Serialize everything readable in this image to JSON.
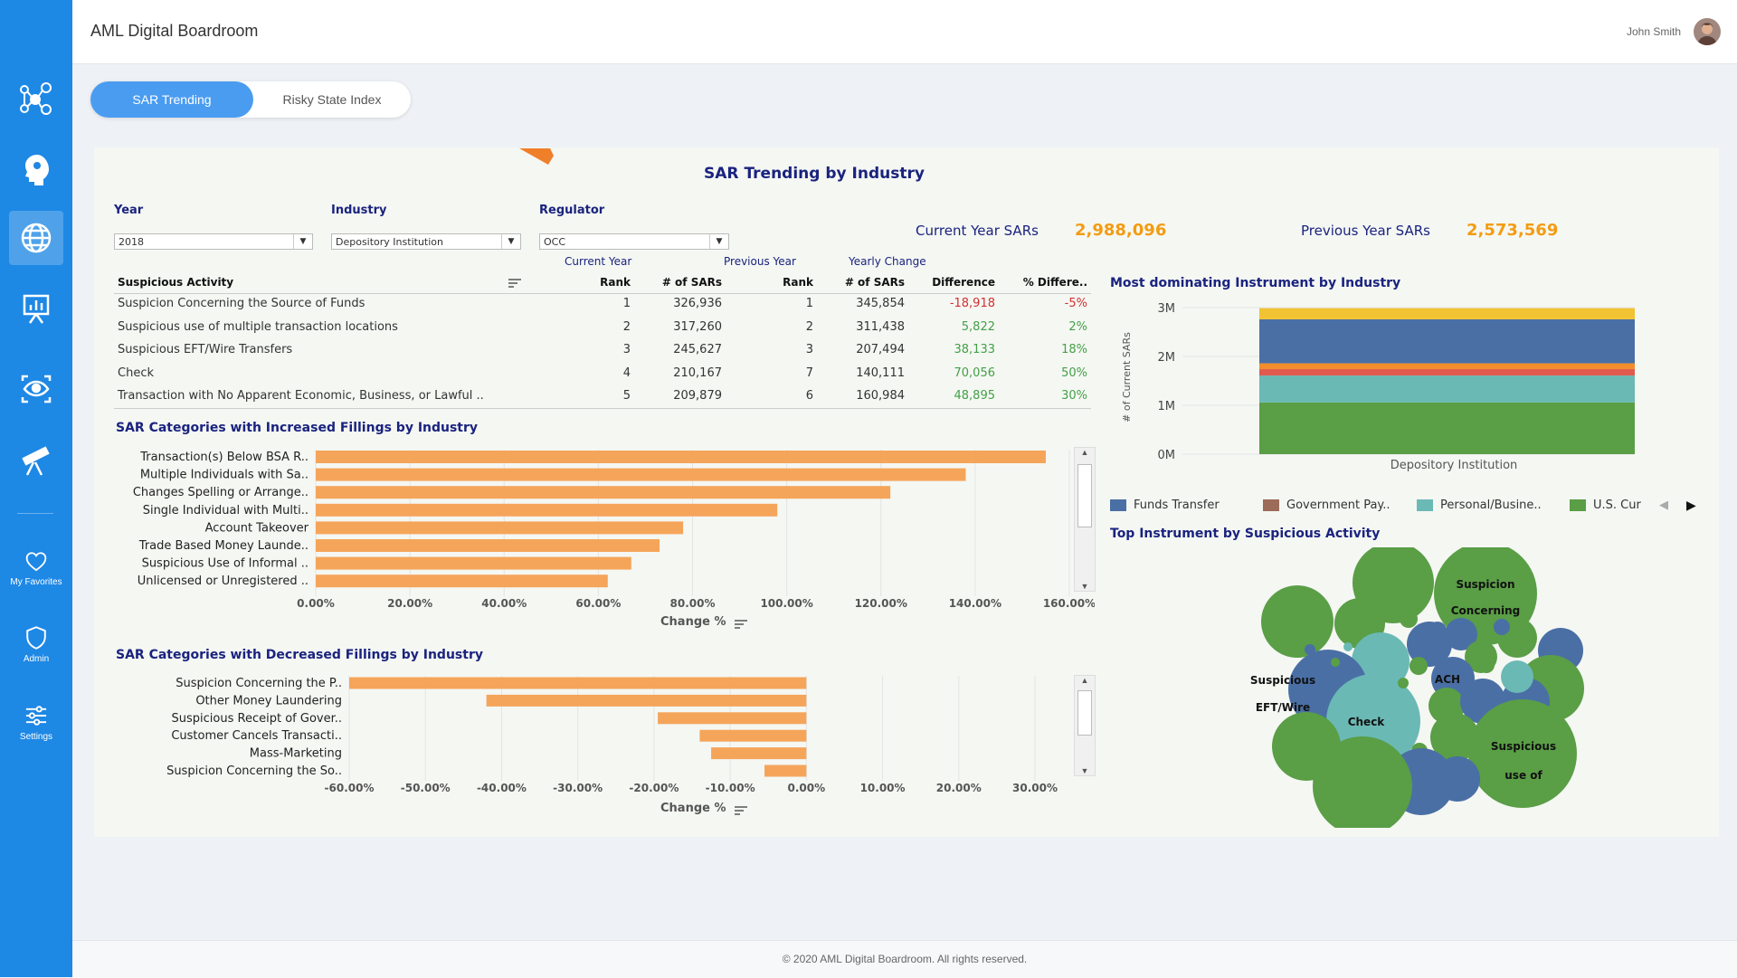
{
  "app": {
    "title": "AML Digital Boardroom",
    "user_name": "John Smith"
  },
  "sidebar": {
    "items": [
      {
        "icon": "network-icon",
        "label": ""
      },
      {
        "icon": "brain-head-icon",
        "label": ""
      },
      {
        "icon": "globe-icon",
        "label": "",
        "active": true
      },
      {
        "icon": "presentation-chart-icon",
        "label": ""
      },
      {
        "icon": "eye-scan-icon",
        "label": ""
      },
      {
        "icon": "telescope-icon",
        "label": ""
      },
      {
        "icon": "heart-icon",
        "label": "My Favorites"
      },
      {
        "icon": "shield-icon",
        "label": "Admin"
      },
      {
        "icon": "sliders-icon",
        "label": "Settings"
      }
    ]
  },
  "tabs": [
    {
      "label": "SAR Trending",
      "active": true
    },
    {
      "label": "Risky State Index",
      "active": false
    }
  ],
  "dashboard": {
    "title": "SAR Trending by Industry",
    "filters": {
      "year": {
        "label": "Year",
        "value": "2018"
      },
      "industry": {
        "label": "Industry",
        "value": "Depository Institution"
      },
      "regulator": {
        "label": "Regulator",
        "value": "OCC"
      }
    },
    "kpis": {
      "current_label": "Current Year SARs",
      "current_value": "2,988,096",
      "previous_label": "Previous Year SARs",
      "previous_value": "2,573,569"
    },
    "table": {
      "group_headers": [
        "Current Year",
        "Previous Year",
        "Yearly Change"
      ],
      "columns": [
        "Suspicious Activity",
        "Rank",
        "# of SARs",
        "Rank",
        "# of SARs",
        "Difference",
        "% Differe.."
      ],
      "rows": [
        [
          "Suspicion Concerning the Source of Funds",
          "1",
          "326,936",
          "1",
          "345,854",
          "-18,918",
          "-5%"
        ],
        [
          "Suspicious use of multiple transaction locations",
          "2",
          "317,260",
          "2",
          "311,438",
          "5,822",
          "2%"
        ],
        [
          "Suspicious EFT/Wire Transfers",
          "3",
          "245,627",
          "3",
          "207,494",
          "38,133",
          "18%"
        ],
        [
          "Check",
          "4",
          "210,167",
          "7",
          "140,111",
          "70,056",
          "50%"
        ],
        [
          "Transaction with No Apparent Economic, Business, or Lawful ..",
          "5",
          "209,879",
          "6",
          "160,984",
          "48,895",
          "30%"
        ]
      ]
    }
  },
  "footer": {
    "text": "© 2020 AML Digital Boardroom. All rights reserved."
  },
  "colors": {
    "accent": "#1e88e5",
    "bar": "#f5a55a",
    "kpi": "#f39c12",
    "title": "#1a237e",
    "green": "#5a9e46",
    "teal": "#6ab9b5",
    "blue": "#4a6fa5"
  },
  "chart_data": [
    {
      "type": "bar",
      "title": "SAR Categories with Increased Fillings by Industry",
      "xlabel": "Change %",
      "orientation": "horizontal",
      "categories": [
        "Transaction(s) Below BSA R..",
        "Multiple Individuals with Sa..",
        "Changes Spelling or Arrange..",
        "Single Individual with Multi..",
        "Account Takeover",
        "Trade Based Money Launde..",
        "Suspicious Use of Informal ..",
        "Unlicensed or Unregistered .."
      ],
      "values": [
        155,
        138,
        122,
        98,
        78,
        73,
        67,
        62
      ],
      "xlim": [
        0,
        160
      ],
      "ticks": [
        "0.00%",
        "20.00%",
        "40.00%",
        "60.00%",
        "80.00%",
        "100.00%",
        "120.00%",
        "140.00%",
        "160.00%"
      ],
      "grid": true
    },
    {
      "type": "bar",
      "title": "SAR Categories with Decreased Fillings by Industry",
      "xlabel": "Change %",
      "orientation": "horizontal",
      "categories": [
        "Suspicion Concerning the P..",
        "Other Money Laundering",
        "Suspicious Receipt of Gover..",
        "Customer Cancels Transacti..",
        "Mass-Marketing",
        "Suspicion Concerning the So.."
      ],
      "values": [
        -60,
        -42,
        -19.5,
        -14,
        -12.5,
        -5.5
      ],
      "xlim": [
        -60,
        30
      ],
      "ticks": [
        "-60.00%",
        "-50.00%",
        "-40.00%",
        "-30.00%",
        "-20.00%",
        "-10.00%",
        "0.00%",
        "10.00%",
        "20.00%",
        "30.00%"
      ],
      "grid": true
    },
    {
      "type": "bar",
      "stacked": true,
      "title": "Most dominating Instrument by Industry",
      "ylabel": "# of Current SARs",
      "categories": [
        "Depository Institution"
      ],
      "ylim": [
        0,
        3000000
      ],
      "yticks": [
        "0M",
        "1M",
        "2M",
        "3M"
      ],
      "series": [
        {
          "name": "U.S. Cur",
          "color": "#5a9e46",
          "values": [
            1060000
          ]
        },
        {
          "name": "Personal/Busine..",
          "color": "#6ab9b5",
          "values": [
            550000
          ]
        },
        {
          "name": "",
          "color": "#e05a4e",
          "values": [
            130000
          ]
        },
        {
          "name": "",
          "color": "#f28e2b",
          "values": [
            120000
          ]
        },
        {
          "name": "Funds Transfer",
          "color": "#4a6fa5",
          "values": [
            900000
          ]
        },
        {
          "name": "",
          "color": "#f1c232",
          "values": [
            228096
          ]
        }
      ],
      "legend": [
        "Funds Transfer",
        "Government Pay..",
        "Personal/Busine..",
        "U.S. Cur"
      ],
      "legend_colors": [
        "#4a6fa5",
        "#9c6b5a",
        "#6ab9b5",
        "#5a9e46"
      ],
      "legend_position": "bottom"
    },
    {
      "type": "bubble",
      "title": "Top Instrument by Suspicious Activity",
      "labels": [
        "Suspicion Concerning",
        "Suspicious EFT/Wire",
        "ACH",
        "Check",
        "Suspicious use of"
      ]
    }
  ]
}
